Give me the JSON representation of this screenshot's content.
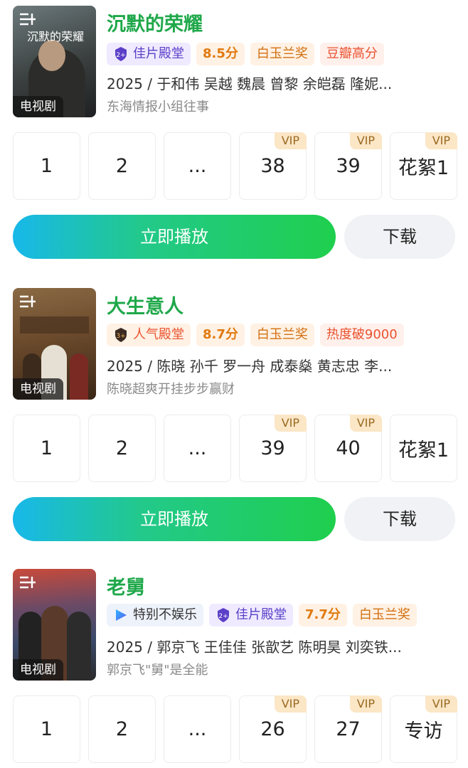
{
  "cards": [
    {
      "title": "沉默的荣耀",
      "poster_caption": "沉默的荣耀",
      "poster_type": "电视剧",
      "tags": [
        {
          "style": "purple",
          "icon": "laurel-2plus-icon",
          "label": "佳片殿堂"
        },
        {
          "style": "score",
          "label": "8.5分"
        },
        {
          "style": "orange",
          "label": "白玉兰奖"
        },
        {
          "style": "red",
          "label": "豆瓣高分"
        }
      ],
      "meta": "2025 / 于和伟  吴越  魏晨  曾黎  余皑磊  隆妮...",
      "subtitle": "东海情报小组往事",
      "episodes": [
        {
          "label": "1",
          "vip": ""
        },
        {
          "label": "2",
          "vip": ""
        },
        {
          "label": "...",
          "vip": ""
        },
        {
          "label": "38",
          "vip": "VIP"
        },
        {
          "label": "39",
          "vip": "VIP"
        },
        {
          "label": "花絮1",
          "vip": "VIP"
        }
      ],
      "play_label": "立即播放",
      "download_label": "下载"
    },
    {
      "title": "大生意人",
      "poster_type": "电视剧",
      "tags": [
        {
          "style": "orange",
          "icon": "laurel-3plus-icon",
          "label": "人气殿堂"
        },
        {
          "style": "score",
          "label": "8.7分"
        },
        {
          "style": "orange",
          "label": "白玉兰奖"
        },
        {
          "style": "red",
          "label": "热度破9000"
        }
      ],
      "meta": "2025 / 陈晓  孙千  罗一舟  成泰燊  黄志忠  李...",
      "subtitle": "陈晓超爽开挂步步赢财",
      "episodes": [
        {
          "label": "1",
          "vip": ""
        },
        {
          "label": "2",
          "vip": ""
        },
        {
          "label": "...",
          "vip": ""
        },
        {
          "label": "39",
          "vip": "VIP"
        },
        {
          "label": "40",
          "vip": "VIP"
        },
        {
          "label": "花絮1",
          "vip": ""
        }
      ],
      "play_label": "立即播放",
      "download_label": "下载"
    },
    {
      "title": "老舅",
      "poster_type": "电视剧",
      "tags": [
        {
          "style": "blue",
          "icon": "play-arrow-icon",
          "label": "特别不娱乐"
        },
        {
          "style": "purple",
          "icon": "laurel-2plus-icon",
          "label": "佳片殿堂"
        },
        {
          "style": "score",
          "label": "7.7分"
        },
        {
          "style": "orange",
          "label": "白玉兰奖"
        }
      ],
      "meta": "2025 / 郭京飞  王佳佳  张歆艺  陈明昊  刘奕铁...",
      "subtitle": "郭京飞\"舅\"是全能",
      "episodes": [
        {
          "label": "1",
          "vip": ""
        },
        {
          "label": "2",
          "vip": ""
        },
        {
          "label": "...",
          "vip": ""
        },
        {
          "label": "26",
          "vip": "VIP"
        },
        {
          "label": "27",
          "vip": "VIP"
        },
        {
          "label": "专访",
          "vip": "VIP"
        }
      ]
    }
  ],
  "colors": {
    "title_green": "#1fa84a",
    "play_gradient_start": "#18b8ea",
    "play_gradient_end": "#1fcf4d"
  }
}
